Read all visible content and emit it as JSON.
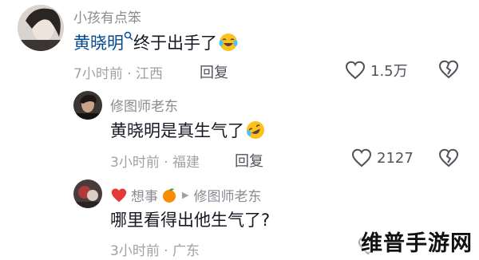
{
  "comments": [
    {
      "user": "小孩有点笨",
      "mention": "黄晓明",
      "text": "终于出手了",
      "time_location": "7小时前 · 江西",
      "reply_label": "回复",
      "likes": "1.5万"
    },
    {
      "user": "修图师老东",
      "text": "黄晓明是真生气了",
      "time_location": "3小时前 · 福建",
      "reply_label": "回复",
      "likes": "2127"
    },
    {
      "user": "想事",
      "reply_arrow": "▶",
      "reply_to": "修图师老东",
      "text": "哪里看得出他生气了?",
      "time_location": "3小时前 · 广东"
    }
  ],
  "watermark": "维普手游网",
  "colors": {
    "mention": "#04498d",
    "name": "#8a8b91",
    "meta": "#a0a1a6",
    "text": "#161823"
  },
  "icons": {
    "like": "heart-outline-icon",
    "dislike": "broken-heart-icon",
    "search": "search-icon",
    "laugh": "tears-of-joy-emoji",
    "rofl": "rolling-laughing-emoji",
    "heart": "red-heart-emoji",
    "orange": "tangerine-emoji"
  }
}
